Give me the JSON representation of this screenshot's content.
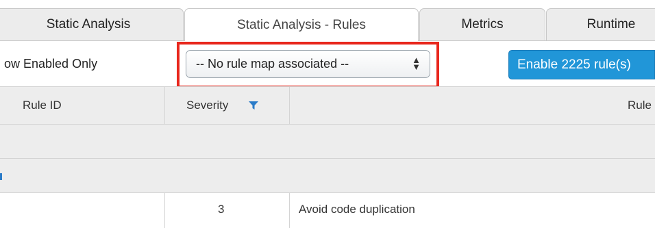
{
  "tabs": [
    {
      "label": "Static Analysis",
      "active": false
    },
    {
      "label": "Static Analysis - Rules",
      "active": true
    },
    {
      "label": "Metrics",
      "active": false
    },
    {
      "label": "Runtime",
      "active": false
    }
  ],
  "toolbar": {
    "show_enabled_label": "ow Enabled Only",
    "rule_map_select_value": "-- No rule map associated --",
    "enable_button_label": "Enable 2225 rule(s)"
  },
  "table": {
    "headers": {
      "rule_id": "Rule ID",
      "severity": "Severity",
      "rule": "Rule"
    },
    "rows": [
      {
        "rule_id": "",
        "severity": "3",
        "rule": "Avoid code duplication"
      }
    ]
  },
  "colors": {
    "highlight": "#e8261c",
    "primary_button": "#2196d8",
    "filter_icon": "#2a7bc8"
  },
  "icons": {
    "filter": "filter-icon",
    "select_arrows": "select-arrows-icon"
  }
}
